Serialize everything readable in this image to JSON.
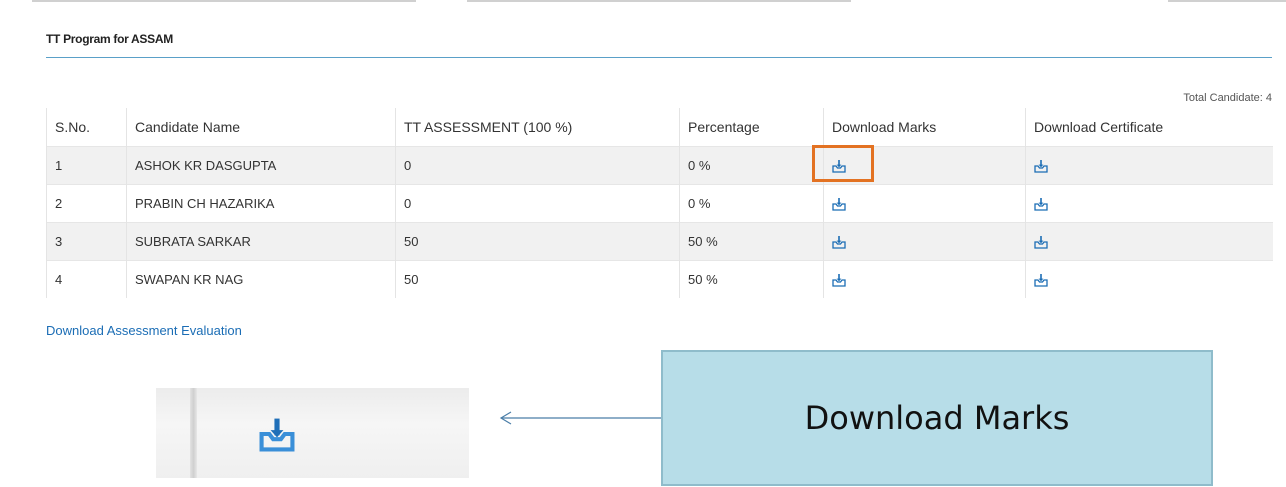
{
  "section": {
    "title": "TT Program for ASSAM"
  },
  "table": {
    "total_label": "Total Candidate: 4",
    "columns": [
      "S.No.",
      "Candidate Name",
      "TT ASSESSMENT (100 %)",
      "Percentage",
      "Download Marks",
      "Download Certificate"
    ],
    "rows": [
      {
        "sno": "1",
        "name": "ASHOK KR DASGUPTA",
        "score": "0",
        "percentage": "0 %"
      },
      {
        "sno": "2",
        "name": "PRABIN CH HAZARIKA",
        "score": "0",
        "percentage": "0 %"
      },
      {
        "sno": "3",
        "name": "SUBRATA SARKAR",
        "score": "50",
        "percentage": "50 %"
      },
      {
        "sno": "4",
        "name": "SWAPAN KR NAG",
        "score": "50",
        "percentage": "50 %"
      }
    ]
  },
  "links": {
    "assessment_evaluation": "Download Assessment Evaluation"
  },
  "callout": {
    "text": "Download Marks"
  },
  "colors": {
    "accent": "#1b6db5",
    "highlight": "#e37222",
    "callout_bg": "#b7dde8"
  },
  "icons": {
    "download": "download-icon",
    "arrow": "arrow-left-icon"
  }
}
